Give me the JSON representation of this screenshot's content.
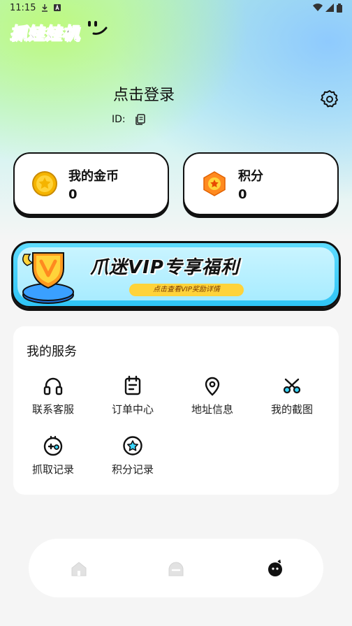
{
  "status_bar": {
    "time": "11:15"
  },
  "app": {
    "logo_text": "抓娃娃机"
  },
  "profile": {
    "login_prompt": "点击登录",
    "id_label": "ID:"
  },
  "stats": {
    "coins": {
      "label": "我的金币",
      "value": "0"
    },
    "points": {
      "label": "积分",
      "value": "0"
    }
  },
  "vip": {
    "title": "爪迷VIP专享福利",
    "subtitle": "点击查看VIP奖励详情"
  },
  "services": {
    "title": "我的服务",
    "items": [
      {
        "label": "联系客服",
        "icon": "headset-icon"
      },
      {
        "label": "订单中心",
        "icon": "order-icon"
      },
      {
        "label": "地址信息",
        "icon": "location-icon"
      },
      {
        "label": "我的截图",
        "icon": "scissors-icon"
      },
      {
        "label": "抓取记录",
        "icon": "gamepad-icon"
      },
      {
        "label": "积分记录",
        "icon": "star-icon"
      }
    ]
  },
  "tabbar": {
    "active": "profile",
    "tabs": [
      "home-icon",
      "chat-icon",
      "profile-icon"
    ]
  },
  "colors": {
    "vip_blue": "#2fc4f6",
    "gold": "#ffd33a",
    "accent_orange": "#ff8a1f"
  }
}
